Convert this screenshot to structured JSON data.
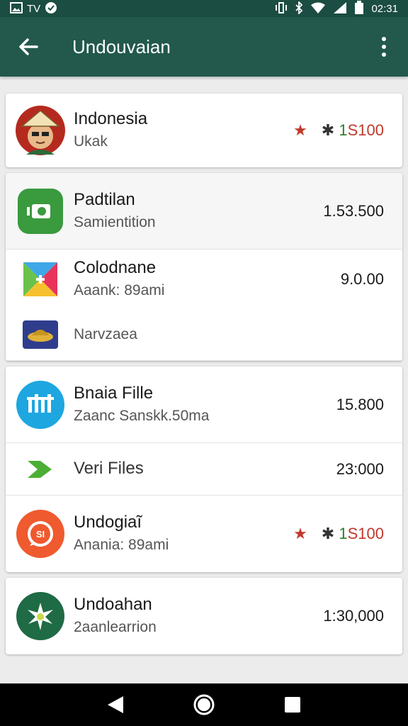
{
  "status_bar": {
    "carrier": "TV",
    "time": "02:31",
    "icons": [
      "gallery-icon",
      "check-circle-icon",
      "vibrate-icon",
      "bluetooth-icon",
      "wifi-icon",
      "signal-icon",
      "battery-icon"
    ]
  },
  "app_bar": {
    "title": "Undouvaian",
    "back_icon": "arrow-left-icon",
    "menu_icon": "more-vertical-icon"
  },
  "cards": [
    {
      "rows": [
        {
          "title": "Indonesia",
          "subtitle": "Ukak",
          "icon": "avatar-person-icon",
          "rating": {
            "star": "★",
            "pin": "✱",
            "prefix": "1",
            "price": "S100"
          }
        }
      ]
    },
    {
      "rows": [
        {
          "title": "Padtilan",
          "subtitle": "Samientition",
          "value": "1.53.500",
          "icon": "green-app-icon"
        },
        {
          "title": "Colodnane",
          "subtitle": "Aaank: 89ami",
          "value": "9.0.00",
          "icon": "colorful-app-icon"
        },
        {
          "title": "",
          "subtitle": "Narvzaea",
          "icon": "hat-app-icon"
        }
      ]
    },
    {
      "rows": [
        {
          "title": "Bnaia Fille",
          "subtitle": "Zaanc Sanskk.50ma",
          "value": "15.800",
          "icon": "files-app-icon"
        },
        {
          "title": "Veri Files",
          "subtitle": "",
          "value": "23:000",
          "icon": "play-arrow-icon"
        },
        {
          "title": "Undogiaĩ",
          "subtitle": "Anania: 89ami",
          "icon": "chat-app-icon",
          "rating": {
            "star": "★",
            "pin": "✱",
            "prefix": "1",
            "price": "S100"
          }
        }
      ]
    },
    {
      "rows": [
        {
          "title": "Undoahan",
          "subtitle": "2aanlearrion",
          "value": "1:30,000",
          "icon": "sparkle-app-icon"
        }
      ]
    }
  ],
  "colors": {
    "app_bar": "#22594c",
    "status_bar": "#1b4d42",
    "accent_red": "#c0392b",
    "accent_green": "#2e7d32"
  },
  "nav_bar": {
    "back": "back-triangle-icon",
    "home": "home-circle-icon",
    "recents": "recents-square-icon"
  }
}
